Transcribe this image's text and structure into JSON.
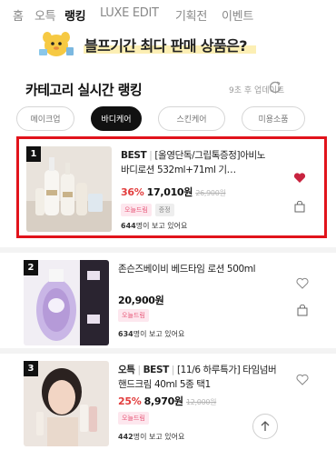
{
  "nav": {
    "tabs": [
      {
        "label": "홈",
        "active": false
      },
      {
        "label": "오특",
        "active": false
      },
      {
        "label": "랭킹",
        "active": true
      },
      {
        "label": "LUXE EDIT",
        "active": false
      },
      {
        "label": "기획전",
        "active": false
      },
      {
        "label": "이벤트",
        "active": false
      }
    ]
  },
  "banner": {
    "text": "블프기간 최다 판매 상품은?",
    "icon": "mascot-character-icon"
  },
  "ranking": {
    "title": "카테고리 실시간 랭킹",
    "update_text": "9초 후 업데이트",
    "refresh_icon": "refresh-icon"
  },
  "chips": [
    {
      "label": "메이크업",
      "active": false
    },
    {
      "label": "바디케어",
      "active": true
    },
    {
      "label": "스킨케어",
      "active": false
    },
    {
      "label": "미용소품",
      "active": false
    }
  ],
  "products": [
    {
      "rank": "1",
      "best": "BEST",
      "name": "[올영단독/그립톡증정]아비노 바디로션 532ml+71ml 기…",
      "discount": "36%",
      "price": "17,010원",
      "original_price": "26,900원",
      "tags": [
        {
          "label": "오늘드림",
          "style": "pink"
        },
        {
          "label": "증정",
          "style": "gray"
        }
      ],
      "viewers_count": "644",
      "viewers_text": "명이 보고 있어요",
      "liked": true,
      "highlighted": true
    },
    {
      "rank": "2",
      "best": "",
      "name": "존슨즈베이비 베드타임 로션 500ml",
      "discount": "",
      "price": "20,900원",
      "original_price": "",
      "tags": [
        {
          "label": "오늘드림",
          "style": "pink"
        }
      ],
      "viewers_count": "634",
      "viewers_text": "명이 보고 있어요",
      "liked": false,
      "highlighted": false
    },
    {
      "rank": "3",
      "best": "BEST",
      "prefix": "오특",
      "name": "[11/6 하루특가] 타임넘버 핸드크림 40ml 5종 택1",
      "discount": "25%",
      "price": "8,970원",
      "original_price": "12,000원",
      "tags": [
        {
          "label": "오늘드림",
          "style": "pink"
        }
      ],
      "viewers_count": "442",
      "viewers_text": "명이 보고 있어요",
      "liked": false,
      "highlighted": false
    }
  ],
  "colors": {
    "accent_red": "#e23d3d",
    "highlight_border": "#e1131b",
    "heart_active": "#c8233f",
    "tag_pink": "#e85a7a"
  }
}
